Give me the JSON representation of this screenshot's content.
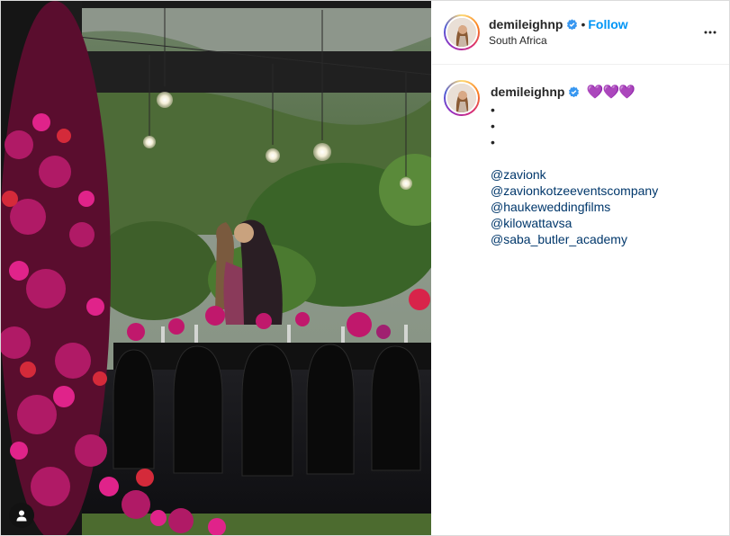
{
  "post": {
    "author": {
      "username": "demileighnp",
      "verified": true,
      "location": "South Africa",
      "follow_label": "Follow"
    },
    "header_separator": "•",
    "caption": {
      "username": "demileighnp",
      "emoji": "💜💜💜",
      "bullets": [
        "•",
        "•",
        "•"
      ],
      "mentions": [
        "@zavionk",
        "@zavionkotzeeventscompany",
        "@haukeweddingfilms",
        "@kilowattavsa",
        "@saba_butler_academy"
      ]
    },
    "icons": {
      "verified": "verified-badge-icon",
      "more": "more-options-icon",
      "tag": "user-tag-icon"
    },
    "colors": {
      "follow": "#0095f6",
      "mention": "#00376b",
      "verified": "#3897f0",
      "hearts": "#a044ff"
    }
  }
}
